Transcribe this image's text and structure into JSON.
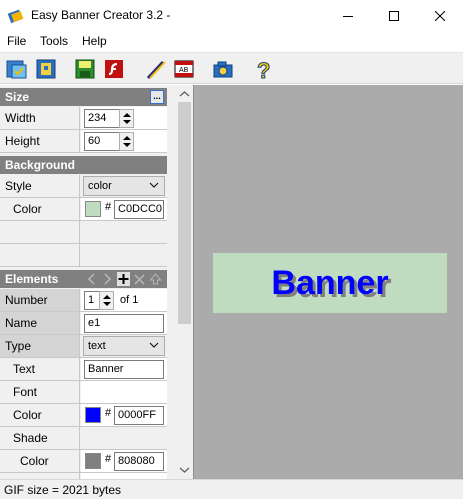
{
  "window": {
    "title": "Easy Banner Creator 3.2 -"
  },
  "menu": {
    "items": [
      "File",
      "Tools",
      "Help"
    ]
  },
  "toolbar": {
    "buttons": [
      "open-icon",
      "save-image-icon",
      "save-icon",
      "flash-icon",
      "wand-icon",
      "animation-icon",
      "camera-icon",
      "help-icon"
    ]
  },
  "size": {
    "header": "Size",
    "dots_label": "...",
    "width_label": "Width",
    "width_value": "234",
    "height_label": "Height",
    "height_value": "60"
  },
  "background": {
    "header": "Background",
    "style_label": "Style",
    "style_value": "color",
    "color_label": "Color",
    "hash": "#",
    "color_value": "C0DCC0",
    "color_hex": "#C0DCC0"
  },
  "elements": {
    "header": "Elements",
    "number_label": "Number",
    "number_value": "1",
    "number_of": "of 1",
    "name_label": "Name",
    "name_value": "e1",
    "type_label": "Type",
    "type_value": "text",
    "text_label": "Text",
    "text_value": "Banner",
    "font_label": "Font",
    "color_label": "Color",
    "hash": "#",
    "color_value": "0000FF",
    "color_hex": "#0000FF",
    "shade_label": "Shade",
    "shade_color_label": "Color",
    "shade_color_value": "808080",
    "shade_color_hex": "#808080"
  },
  "banner": {
    "text": "Banner",
    "background": "#C0DCC0",
    "text_color": "#0000FF",
    "shade_color": "#808080"
  },
  "status": {
    "text": "GIF size = 2021 bytes"
  }
}
